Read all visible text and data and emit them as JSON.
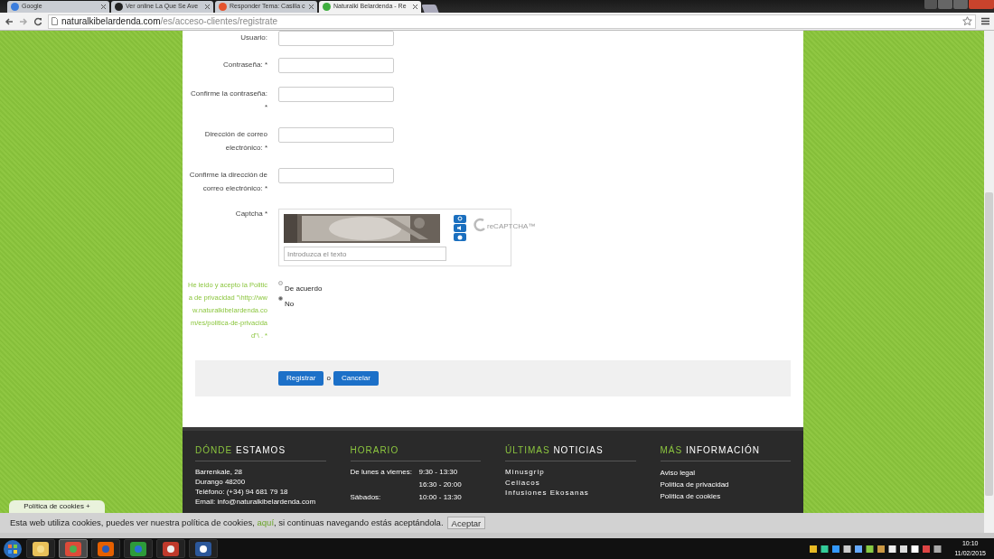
{
  "browser": {
    "tabs": [
      {
        "title": "Google",
        "selected": false
      },
      {
        "title": "Ver online La Que Se Ave",
        "selected": false
      },
      {
        "title": "Responder Tema: Casilla c",
        "selected": false
      },
      {
        "title": "Naturalki Belardenda - Re",
        "selected": true
      }
    ],
    "url": {
      "host": "naturalkibelardenda.com",
      "path": "/es/acceso-clientes/registrate"
    }
  },
  "form": {
    "fields": [
      {
        "label": "Usuario:"
      },
      {
        "label": "Contraseña: *"
      },
      {
        "label": "Confirme la contraseña: *"
      },
      {
        "label": "Dirección de correo electrónico: *"
      },
      {
        "label": "Confirme la dirección de correo electrónico: *"
      }
    ],
    "captcha": {
      "label": "Captcha *",
      "placeholder": "Introduzca el texto",
      "logo": "reCAPTCHA™"
    },
    "privacy": {
      "label": "He leido y acepto la Politica de privacidad \"\\http://www.naturalkibelardenda.com/es/politica-de-privacidad\"\\ . *",
      "options": [
        {
          "label": "De acuerdo",
          "selected": false
        },
        {
          "label": "No",
          "selected": true
        }
      ]
    },
    "actions": {
      "submit": "Registrar",
      "separator": "o",
      "cancel": "Cancelar"
    }
  },
  "footer": {
    "columns": [
      {
        "accent": "DÓNDE",
        "rest": "ESTAMOS",
        "kind": "lines",
        "lines": [
          "Barrenkale, 28",
          "Durango 48200",
          "Teléfono: (+34) 94 681 79 18",
          "Email: info@naturalkibelardenda.com"
        ]
      },
      {
        "accent": "HORARIO",
        "kind": "hours",
        "rows": [
          {
            "day": "De lunes a viernes:",
            "time": "9:30 - 13:30"
          },
          {
            "time": "16:30 - 20:00"
          },
          {
            "day": "Sábados:",
            "time": "10:00 - 13:30"
          }
        ]
      },
      {
        "accent": "ÚLTIMAS",
        "rest": "NOTICIAS",
        "kind": "news",
        "lines": [
          "Minusgrip",
          "Celiacos",
          "Infusiones Ekosanas"
        ]
      },
      {
        "accent": "MÁS",
        "rest": "INFORMACIÓN",
        "kind": "links",
        "lines": [
          "Aviso legal",
          "Política de privacidad",
          "Política de cookies"
        ]
      }
    ]
  },
  "cookies": {
    "tab": "Política de cookies +",
    "before": "Esta web utiliza cookies, puedes ver nuestra política de cookies, ",
    "link": "aquí",
    "after": ", si continuas navegando estás aceptándola.",
    "button": "Aceptar"
  },
  "taskbar": {
    "apps": [
      {
        "kind": "explorer",
        "selected": false
      },
      {
        "kind": "chrome",
        "selected": true
      },
      {
        "kind": "firefox",
        "selected": false
      },
      {
        "kind": "transfer",
        "selected": false
      },
      {
        "kind": "cleaner",
        "selected": false
      },
      {
        "kind": "word",
        "selected": false
      }
    ],
    "time": "10:10",
    "date": "11/02/2015"
  }
}
